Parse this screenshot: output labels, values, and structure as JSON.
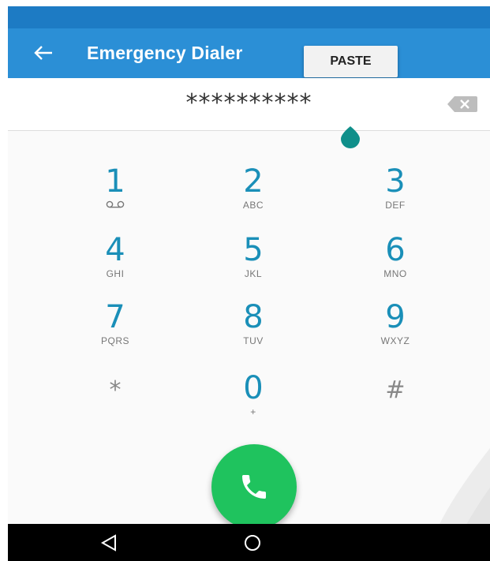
{
  "app_bar": {
    "title": "Emergency Dialer",
    "back_icon": "arrow-left-icon",
    "color": "#2b8fd6",
    "status_color": "#1d7bc4"
  },
  "context_menu": {
    "paste_label": "PASTE"
  },
  "dialed": {
    "digits": "**********",
    "backspace_icon": "backspace-icon"
  },
  "keypad": {
    "keys": [
      {
        "digit": "1",
        "letters": "",
        "icon": "voicemail-icon"
      },
      {
        "digit": "2",
        "letters": "ABC"
      },
      {
        "digit": "3",
        "letters": "DEF"
      },
      {
        "digit": "4",
        "letters": "GHI"
      },
      {
        "digit": "5",
        "letters": "JKL"
      },
      {
        "digit": "6",
        "letters": "MNO"
      },
      {
        "digit": "7",
        "letters": "PQRS"
      },
      {
        "digit": "8",
        "letters": "TUV"
      },
      {
        "digit": "9",
        "letters": "WXYZ"
      },
      {
        "digit": "*",
        "letters": ""
      },
      {
        "digit": "0",
        "letters": "+"
      },
      {
        "digit": "#",
        "letters": ""
      }
    ],
    "digit_color": "#1a8fb8"
  },
  "call": {
    "icon": "phone-icon",
    "color": "#1fc35e"
  },
  "nav": {
    "back_icon": "nav-back-icon",
    "home_icon": "nav-home-icon"
  }
}
